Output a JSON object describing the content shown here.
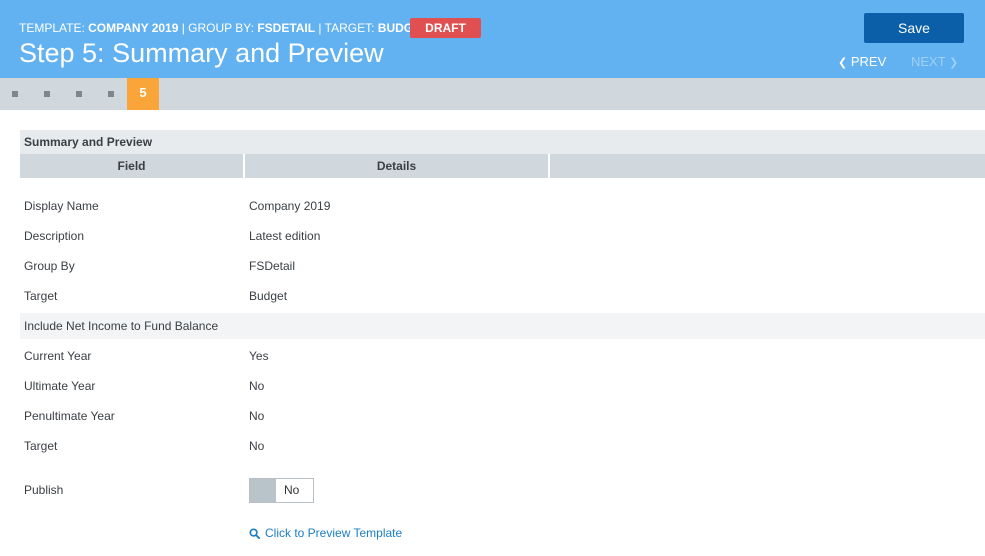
{
  "header": {
    "template_prefix": "TEMPLATE: ",
    "template_value": "COMPANY 2019",
    "group_prefix": " | GROUP BY: ",
    "group_value": "FSDETAIL",
    "target_prefix": " | TARGET: ",
    "target_value": "BUDGET",
    "badge": "DRAFT",
    "title": "Step 5: Summary and Preview",
    "save_label": "Save",
    "prev_label": "PREV",
    "next_label": "NEXT"
  },
  "steps": {
    "current": "5",
    "total": 5
  },
  "summary": {
    "panel_title": "Summary and Preview",
    "columns": [
      "Field",
      "Details",
      ""
    ],
    "rows": [
      {
        "field": "Display Name",
        "details": "Company 2019"
      },
      {
        "field": "Description",
        "details": "Latest edition"
      },
      {
        "field": "Group By",
        "details": "FSDetail"
      },
      {
        "field": "Target",
        "details": "Budget"
      },
      {
        "field": "Include Net Income to Fund Balance",
        "details": ""
      },
      {
        "field": "Current Year",
        "details": "Yes"
      },
      {
        "field": "Ultimate Year",
        "details": "No"
      },
      {
        "field": "Penultimate Year",
        "details": "No"
      },
      {
        "field": "Target",
        "details": "No"
      }
    ],
    "publish_label": "Publish",
    "publish_value": "No",
    "preview_link": "Click to Preview Template"
  },
  "colors": {
    "header_bg": "#62b1f0",
    "save_button": "#0a5fa8",
    "draft_badge": "#e05050",
    "active_step": "#f9a53a",
    "link": "#1b7ec6"
  },
  "icons": {
    "prev": "chevron-left-icon",
    "next": "chevron-right-icon",
    "preview": "search-icon"
  }
}
